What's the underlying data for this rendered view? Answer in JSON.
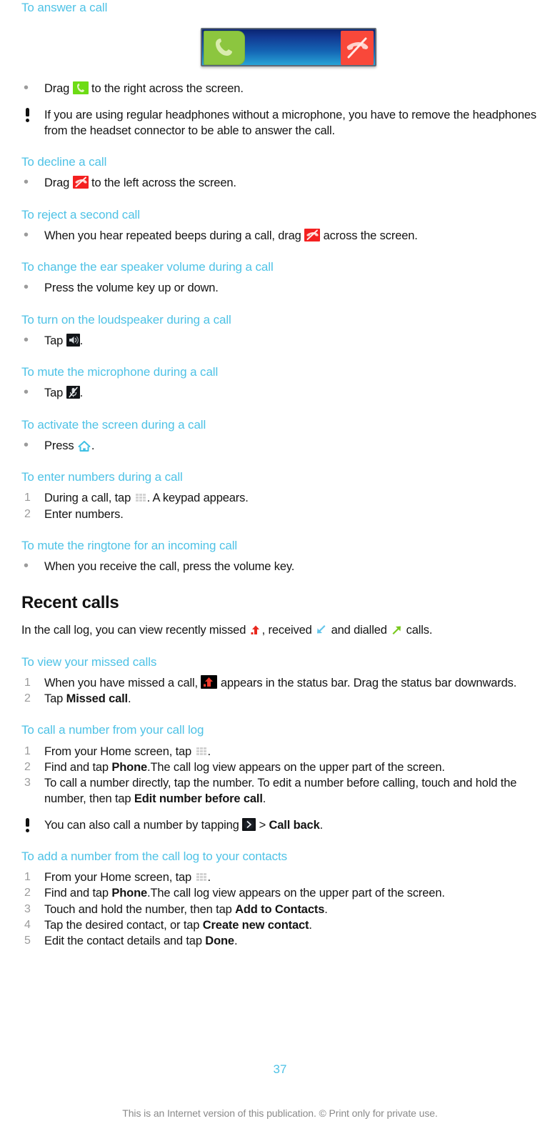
{
  "page": {
    "number": "37",
    "footer": "This is an Internet version of this publication. © Print only for private use.",
    "heading_color": "#4ec2e6",
    "body_color": "#141414"
  },
  "sections": {
    "answer_call": {
      "heading": "To answer a call",
      "figure": {
        "name": "incoming-call-slider",
        "answer_icon": "phone-handset-icon",
        "decline_icon": "phone-handset-crossed-icon",
        "answer_color": "#8cc63f",
        "decline_color": "#f9483a",
        "bar_color": "#1466b5"
      },
      "steps": [
        {
          "marker": "•",
          "text_before": "Drag ",
          "icon": "answer-call-icon",
          "text_after": " to the right across the screen."
        }
      ],
      "note": "If you are using regular headphones without a microphone, you have to remove the headphones from the headset connector to be able to answer the call."
    },
    "decline_call": {
      "heading": "To decline a call",
      "steps": [
        {
          "marker": "•",
          "text_before": "Drag ",
          "icon": "decline-call-icon",
          "text_after": " to the left across the screen."
        }
      ]
    },
    "reject_second_call": {
      "heading": "To reject a second call",
      "steps": [
        {
          "marker": "•",
          "text_before": "When you hear repeated beeps during a call, drag ",
          "icon": "decline-call-icon",
          "text_after": " across the screen."
        }
      ]
    },
    "ear_speaker_volume": {
      "heading": "To change the ear speaker volume during a call",
      "steps": [
        {
          "marker": "•",
          "text": "Press the volume key up or down."
        }
      ]
    },
    "loudspeaker": {
      "heading": "To turn on the loudspeaker during a call",
      "steps": [
        {
          "marker": "•",
          "text_before": "Tap ",
          "icon": "loudspeaker-icon",
          "text_after": "."
        }
      ]
    },
    "mute_microphone": {
      "heading": "To mute the microphone during a call",
      "steps": [
        {
          "marker": "•",
          "text_before": "Tap ",
          "icon": "microphone-mute-icon",
          "text_after": "."
        }
      ]
    },
    "activate_screen": {
      "heading": "To activate the screen during a call",
      "steps": [
        {
          "marker": "•",
          "text_before": "Press ",
          "icon": "home-key-icon",
          "text_after": "."
        }
      ]
    },
    "enter_numbers": {
      "heading": "To enter numbers during a call",
      "steps": [
        {
          "marker": "1",
          "text_before": "During a call, tap ",
          "icon": "keypad-icon",
          "text_after": ". A keypad appears."
        },
        {
          "marker": "2",
          "text": "Enter numbers."
        }
      ]
    },
    "mute_ringtone": {
      "heading": "To mute the ringtone for an incoming call",
      "steps": [
        {
          "marker": "•",
          "text": "When you receive the call, press the volume key."
        }
      ]
    },
    "recent_calls": {
      "heading": "Recent calls",
      "intro": {
        "part1": "In the call log, you can view recently missed ",
        "icon1": "missed-call-arrow-icon",
        "part2": ", received ",
        "icon2": "received-call-arrow-icon",
        "part3": " and dialled ",
        "icon3": "dialled-call-arrow-icon",
        "part4": " calls."
      }
    },
    "view_missed_calls": {
      "heading": "To view your missed calls",
      "steps": [
        {
          "marker": "1",
          "text_before": "When you have missed a call, ",
          "icon": "missed-call-status-icon",
          "text_after": " appears in the status bar. Drag the status bar downwards."
        },
        {
          "marker": "2",
          "text_before": "Tap ",
          "bold": "Missed call",
          "text_after": "."
        }
      ]
    },
    "call_from_log": {
      "heading": "To call a number from your call log",
      "steps": [
        {
          "marker": "1",
          "text_before": "From your Home screen, tap ",
          "icon": "app-grid-icon",
          "text_after": "."
        },
        {
          "marker": "2",
          "text_before": "Find and tap ",
          "bold": "Phone",
          "text_after": ".The call log view appears on the upper part of the screen."
        },
        {
          "marker": "3",
          "text_before": "To call a number directly, tap the number. To edit a number before calling, touch and hold the number, then tap ",
          "bold": "Edit number before call",
          "text_after": "."
        }
      ],
      "note": {
        "part1": "You can also call a number by tapping ",
        "icon": "chevron-right-icon",
        "part2": " > ",
        "bold": "Call back",
        "part3": "."
      }
    },
    "add_number_to_contacts": {
      "heading": "To add a number from the call log to your contacts",
      "steps": [
        {
          "marker": "1",
          "text_before": "From your Home screen, tap ",
          "icon": "app-grid-icon",
          "text_after": "."
        },
        {
          "marker": "2",
          "text_before": "Find and tap ",
          "bold": "Phone",
          "text_after": ".The call log view appears on the upper part of the screen."
        },
        {
          "marker": "3",
          "text_before": "Touch and hold the number, then tap ",
          "bold": "Add to Contacts",
          "text_after": "."
        },
        {
          "marker": "4",
          "text_before": "Tap the desired contact, or tap ",
          "bold": "Create new contact",
          "text_after": "."
        },
        {
          "marker": "5",
          "text_before": "Edit the contact details and tap ",
          "bold": "Done",
          "text_after": "."
        }
      ]
    }
  }
}
